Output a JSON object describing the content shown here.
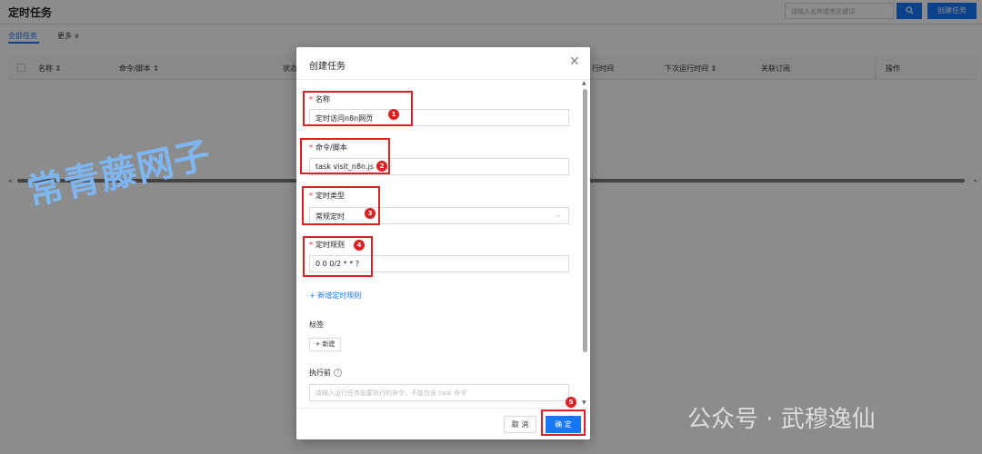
{
  "page": {
    "title": "定时任务",
    "search_placeholder": "请输入名称或者关键词",
    "search_icon": "search-icon",
    "create_button": "创建任务",
    "tabs": {
      "all": "全部任务",
      "more": "更多 ∨"
    },
    "columns": [
      "名称 ⇕",
      "命令/脚本 ⇕",
      "状态",
      "行时间",
      "下次运行时间 ⇕",
      "关联订阅",
      "操作"
    ]
  },
  "modal": {
    "title": "创建任务",
    "close_icon": "close-icon",
    "name": {
      "label": "名称",
      "required_mark": "*",
      "value": "定时访问n8n网页"
    },
    "command": {
      "label": "命令/脚本",
      "required_mark": "*",
      "value": "task visit_n8n.js"
    },
    "schedule_type": {
      "label": "定时类型",
      "required_mark": "*",
      "value": "常规定时",
      "chevron_icon": "chevron-down-icon"
    },
    "schedule_rule": {
      "label": "定时规则",
      "required_mark": "*",
      "value": "0 0 0/2 * * ?"
    },
    "add_rule": "+ 新增定时规则",
    "tags": {
      "label": "标签",
      "new_button": "+ 新建"
    },
    "before_exec": {
      "label": "执行前",
      "help_icon": "question-circle-icon",
      "placeholder": "请输入运行任务前要执行的命令，不能包含 task 命令"
    },
    "cancel_button": "取 消",
    "ok_button": "确 定"
  },
  "annotations": [
    "1",
    "2",
    "3",
    "4",
    "5"
  ],
  "watermarks": {
    "left": "常青藤网子",
    "right": "公众号 · 武穆逸仙"
  },
  "colors": {
    "primary": "#1677ff",
    "annotation_red": "#e02020",
    "required_red": "#f5222d"
  }
}
